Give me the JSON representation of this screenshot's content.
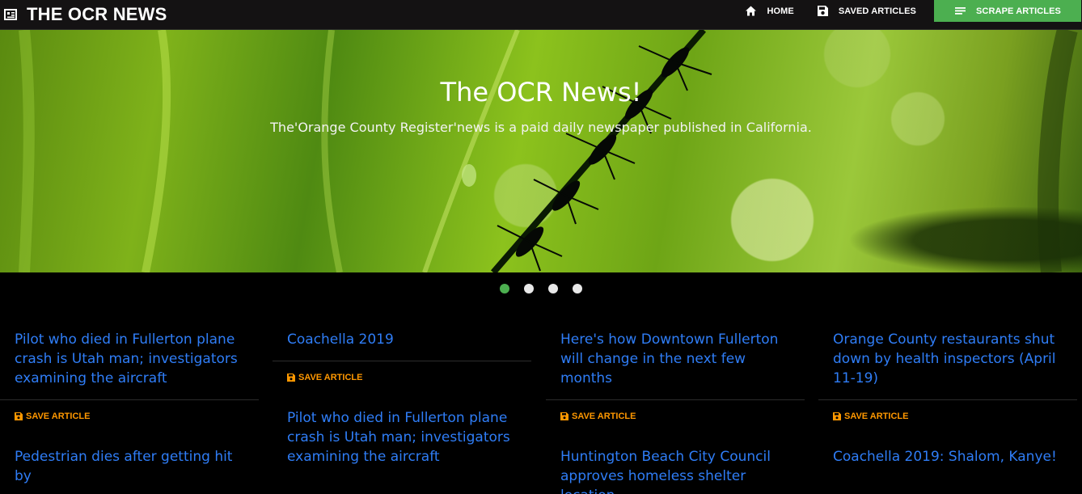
{
  "navbar": {
    "brand": "THE OCR NEWS",
    "brand_icon": "newspaper-icon",
    "links": [
      {
        "label": "HOME",
        "icon": "home-icon"
      },
      {
        "label": "SAVED ARTICLES",
        "icon": "floppy-disk-icon"
      },
      {
        "label": "SCRAPE ARTICLES",
        "icon": "list-icon"
      }
    ],
    "colors": {
      "bar": "#141213",
      "scrape_button": "#4caf50"
    }
  },
  "hero": {
    "title": "The OCR News!",
    "subtitle": "The'Orange County Register'news is a paid daily newspaper published in California.",
    "slides": 4,
    "active_slide": 1
  },
  "articles": {
    "save_label": "SAVE ARTICLE",
    "save_icon": "floppy-disk-icon",
    "colors": {
      "title": "#2f7df6",
      "save": "#ff9800"
    },
    "columns": [
      {
        "cards": [
          {
            "title": "Pilot who died in Fullerton plane crash is Utah man; investigators examining the aircraft"
          },
          {
            "title": "Pedestrian dies after getting hit by"
          }
        ]
      },
      {
        "cards": [
          {
            "title": "Coachella 2019"
          },
          {
            "title": "Pilot who died in Fullerton plane crash is Utah man; investigators examining the aircraft"
          }
        ]
      },
      {
        "cards": [
          {
            "title": "Here's how Downtown Fullerton will change in the next few months"
          },
          {
            "title": "Huntington Beach City Council approves homeless shelter location"
          }
        ]
      },
      {
        "cards": [
          {
            "title": "Orange County restaurants shut down by health inspectors (April 11-19)"
          },
          {
            "title": "Coachella 2019: Shalom, Kanye!"
          }
        ]
      }
    ]
  }
}
